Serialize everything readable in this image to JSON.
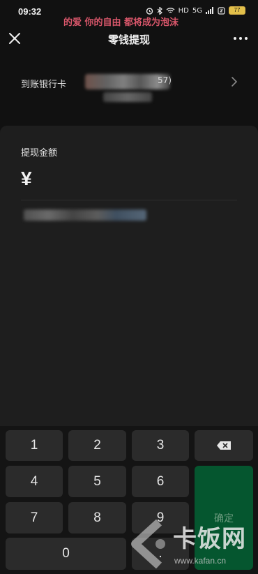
{
  "status_bar": {
    "time": "09:32",
    "lyric": "的爱 你的自由 都将成为泡沫",
    "hd_label": "HD",
    "network_label": "5G",
    "battery_level": "77"
  },
  "header": {
    "title": "零钱提现"
  },
  "bank": {
    "label": "到账银行卡",
    "card_tail": "57)"
  },
  "amount": {
    "label": "提现金额",
    "currency_symbol": "¥",
    "value": ""
  },
  "keypad": {
    "keys": [
      "1",
      "2",
      "3",
      "4",
      "5",
      "6",
      "7",
      "8",
      "9",
      "0",
      "."
    ],
    "confirm_label": "确定"
  },
  "watermark": {
    "text": "卡饭网",
    "url": "www.kafan.cn"
  },
  "colors": {
    "background": "#111111",
    "sheet": "#1e1e1e",
    "key": "#2b2b2b",
    "confirm": "#05562f",
    "lyric": "#d8566a"
  }
}
